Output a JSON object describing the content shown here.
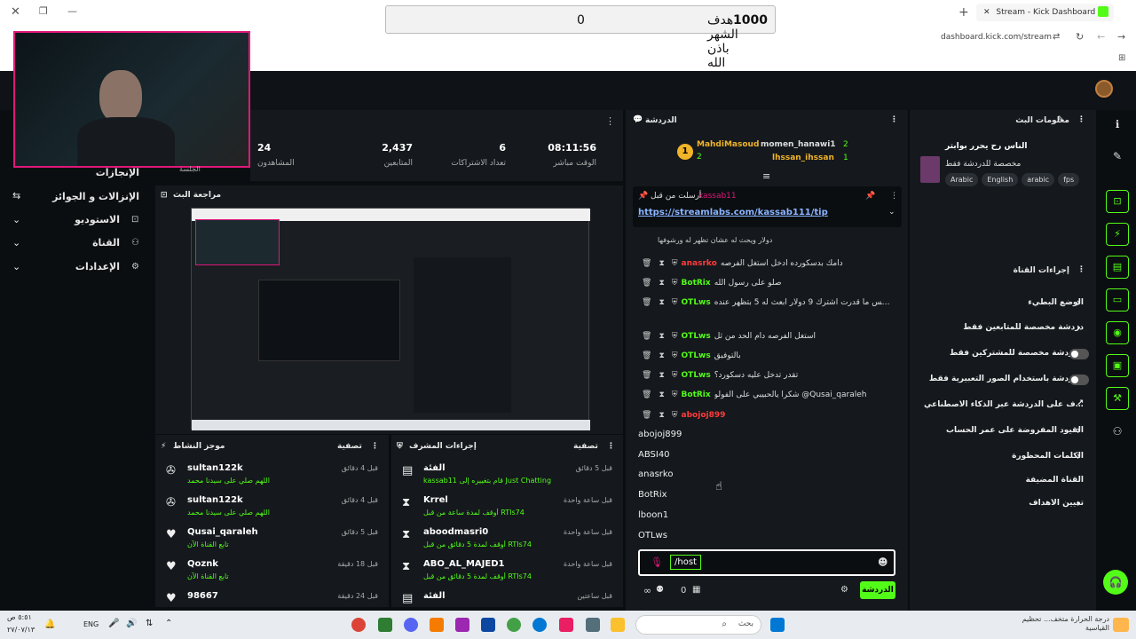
{
  "browser": {
    "tab_title": "Stream - Kick Dashboard",
    "url": "dashboard.kick.com/stream",
    "goal_title": "هدف الشهر باذن الله",
    "goal_current": "0",
    "goal_target": "1000"
  },
  "sidebar": {
    "items": [
      {
        "label": "الإنجازات",
        "icon": "trophy-icon"
      },
      {
        "label": "الإنزالات و الجوائز",
        "icon": "gift-icon"
      },
      {
        "label": "الاستوديو",
        "icon": "studio-icon"
      },
      {
        "label": "القناة",
        "icon": "channel-icon"
      },
      {
        "label": "الإعدادات",
        "icon": "settings-icon"
      }
    ]
  },
  "stats": {
    "items": [
      {
        "value": "24",
        "label": "الجلسة"
      },
      {
        "value": "2,437",
        "label": "المشاهدون"
      },
      {
        "value": "6",
        "label": "المتابعين"
      },
      {
        "value": "08:11:56",
        "label": "تعداد الاشتراكات"
      }
    ],
    "live_label": "الوقت مباشر"
  },
  "preview": {
    "title": "مراجعة البث"
  },
  "activity": {
    "title": "موجز النشاط",
    "filter": "تصفية",
    "rows": [
      {
        "icon": "subscribe-icon",
        "name": "sultan122k",
        "sub": "اللهم صلي على سيدنا محمد",
        "time": "قبل 4 دقائق"
      },
      {
        "icon": "subscribe-icon",
        "name": "sultan122k",
        "sub": "اللهم صلي على سيدنا محمد",
        "time": "قبل 4 دقائق"
      },
      {
        "icon": "heart-icon",
        "name": "Qusai_qaraleh",
        "sub": "تابع القناة الآن",
        "time": "قبل 5 دقائق"
      },
      {
        "icon": "heart-icon",
        "name": "Qoznk",
        "sub": "تابع القناة الآن",
        "time": "قبل 18 دقيقة"
      },
      {
        "icon": "heart-icon",
        "name": "98667",
        "sub": "",
        "time": "قبل 24 دقيقة"
      }
    ]
  },
  "modactions": {
    "title": "إجراءات المشرف",
    "filter": "تصفية",
    "rows": [
      {
        "icon": "category-icon",
        "name": "الفئة",
        "sub": "kassab11 قام بتغييره إلى Just Chatting",
        "time": "قبل 5 دقائق"
      },
      {
        "icon": "timeout-icon",
        "name": "Krrel",
        "sub": "أوقف لمدة ساعة من قبل RTIs74",
        "time": "قبل ساعة واحدة"
      },
      {
        "icon": "timeout-icon",
        "name": "aboodmasri0",
        "sub": "أوقف لمدة 5 دقائق من قبل RTIs74",
        "time": "قبل ساعة واحدة"
      },
      {
        "icon": "timeout-icon",
        "name": "ABO_AL_MAJED1",
        "sub": "أوقف لمدة 5 دقائق من قبل RTIs74",
        "time": "قبل ساعة واحدة"
      },
      {
        "icon": "category-icon",
        "name": "الفئة",
        "sub": "",
        "time": "قبل ساعتين"
      }
    ]
  },
  "chat": {
    "title": "الدردشة",
    "top_gifters": [
      {
        "name": "momen_hanawi1",
        "count": "2"
      },
      {
        "name": "MahdiMasoud",
        "count": "2"
      },
      {
        "name": "lhssan_ihssan",
        "count": "1"
      }
    ],
    "pinned_label": "أرسلت من قبل",
    "pinned_user": "kassab11",
    "pinned_link": "https://streamlabs.com/kassab111/tip",
    "pinned_extra": "دولار ويحث له عشان تظهر له ورشوفها",
    "messages": [
      {
        "user": "anasrko",
        "color": "#ff3b3b",
        "text": "دامك بدسكورده ادخل استغل الفرصه"
      },
      {
        "user": "BotRix",
        "color": "#53fc18",
        "text": "صلو على رسول الله"
      },
      {
        "user": "OTLws",
        "color": "#53fc18",
        "text": "انا عندك متابعة من ساعة بس ما قدرت اشترك 9 دولار ابعث له 5 بتظهر عنده"
      },
      {
        "user": "OTLws",
        "color": "#53fc18",
        "text": "استغل الفرصه دام الحد من ثل"
      },
      {
        "user": "OTLws",
        "color": "#53fc18",
        "text": "بالتوفيق"
      },
      {
        "user": "OTLws",
        "color": "#53fc18",
        "text": "تقدر تدخل عليه دسكورد؟"
      },
      {
        "user": "BotRix",
        "color": "#53fc18",
        "text": "شكرا يالحبيبي على الفولو @Qusai_qaraleh"
      },
      {
        "user": "abojoj899",
        "color": "#ff3b3b",
        "text": ""
      }
    ],
    "suggestions": [
      "abojoj899",
      "ABSI40",
      "anasrko",
      "BotRix",
      "lboon1",
      "OTLws"
    ],
    "input_value": "/host",
    "viewer_count": "0",
    "send_label": "الدردشة"
  },
  "info": {
    "title": "معلومات البث",
    "stream_title": "الناس رح يحرر بوابتر",
    "category": "مخصصة للدردشة فقط",
    "tags": [
      "Arabic",
      "English",
      "arabic",
      "fps"
    ]
  },
  "chatsettings": {
    "title": "إجراءات القناة",
    "rows": [
      {
        "label": "الوضع البطيء",
        "kind": "arrow"
      },
      {
        "label": "دردشة مخصصة للمتابعين فقط",
        "kind": "arrow"
      },
      {
        "label": "الدردشة مخصصة للمشتركين فقط",
        "kind": "toggle"
      },
      {
        "label": "الدردشة باستخدام الصور التعبيرية فقط",
        "kind": "toggle"
      },
      {
        "label": "الإشراف على الدردشة عبر الذكاء الاصطناعي",
        "kind": "link"
      },
      {
        "label": "القيود المفروضة على عمر الحساب",
        "kind": "arrow"
      },
      {
        "label": "الكلمات المحظورة",
        "kind": "arrow"
      },
      {
        "label": "القناة المضيفة",
        "kind": "none"
      },
      {
        "label": "تعيين الأهداف",
        "kind": "arrow"
      }
    ]
  },
  "taskbar": {
    "search_placeholder": "بحث",
    "lang": "ENG",
    "time": "٥:٥١ ص",
    "date": "٢٧/٠٧/١٣",
    "weather": "درجة الحرارة متخف... تحظيم القياسية"
  }
}
